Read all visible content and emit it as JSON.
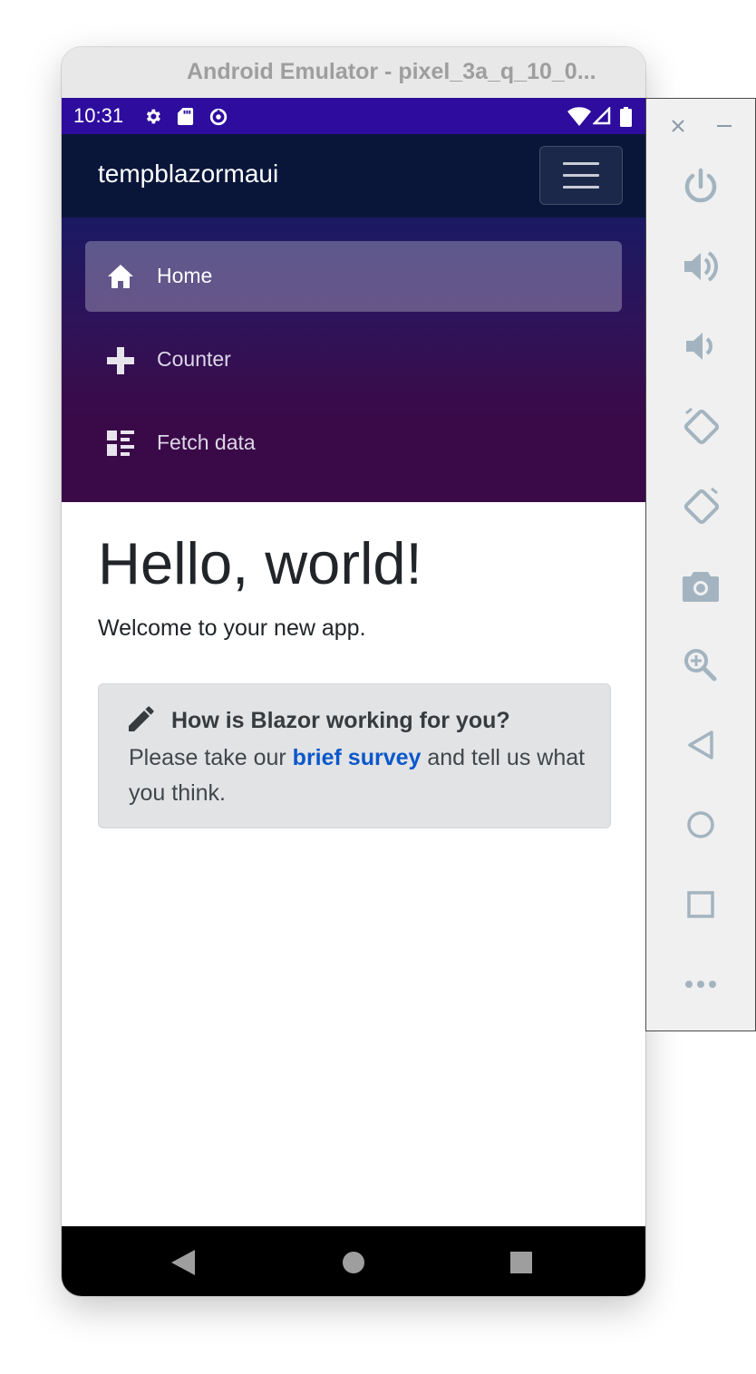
{
  "window": {
    "title": "Android Emulator - pixel_3a_q_10_0..."
  },
  "statusbar": {
    "time": "10:31",
    "left_icons": [
      "settings-icon",
      "sd-card-icon",
      "data-saver-icon"
    ],
    "right_icons": [
      "wifi-icon",
      "signal-icon",
      "battery-icon"
    ],
    "color": "#2d0c9e"
  },
  "app": {
    "brand": "tempblazormaui",
    "nav": [
      {
        "label": "Home",
        "icon": "home-icon",
        "active": true
      },
      {
        "label": "Counter",
        "icon": "plus-icon",
        "active": false
      },
      {
        "label": "Fetch data",
        "icon": "list-rich-icon",
        "active": false
      }
    ],
    "main": {
      "heading": "Hello, world!",
      "welcome": "Welcome to your new app.",
      "survey": {
        "question": "How is Blazor working for you?",
        "text_before": "Please take our ",
        "link": "brief survey",
        "text_after": " and tell us what you think."
      }
    }
  },
  "emulator_controls": [
    "close-icon",
    "minimize-icon",
    "power-icon",
    "volume-up-icon",
    "volume-down-icon",
    "rotate-left-icon",
    "rotate-right-icon",
    "camera-icon",
    "zoom-icon",
    "back-icon",
    "home-circle-icon",
    "overview-icon",
    "more-icon"
  ]
}
